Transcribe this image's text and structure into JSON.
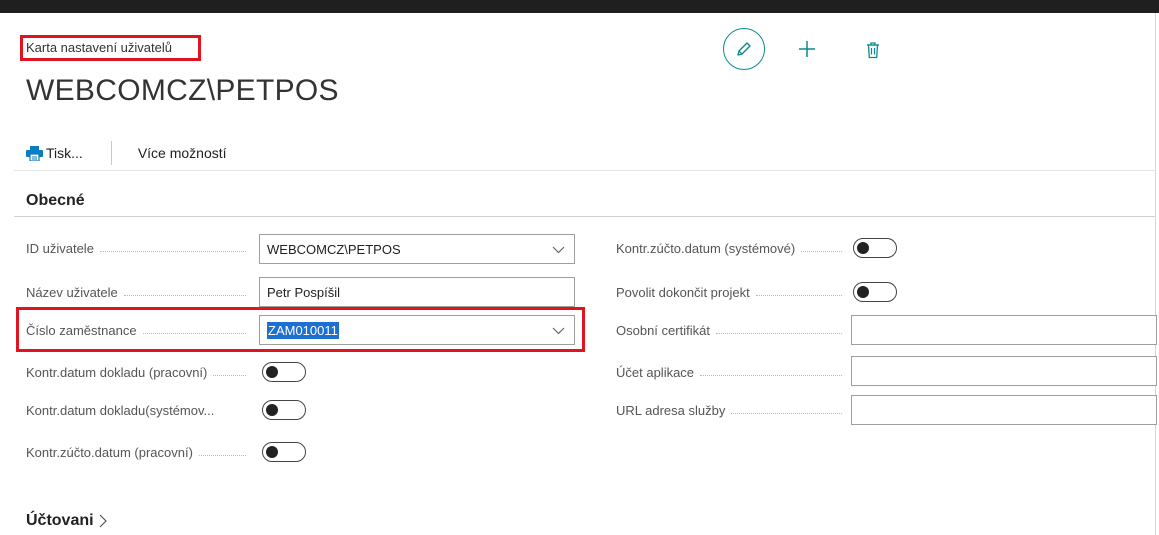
{
  "header": {
    "breadcrumb": "Karta nastavení uživatelů",
    "title": "WEBCOMCZ\\PETPOS"
  },
  "actions": {
    "print_label": "Tisk...",
    "more_label": "Více možností"
  },
  "section": {
    "title": "Obecné"
  },
  "left_fields": {
    "user_id": {
      "label": "ID uživatele",
      "value": "WEBCOMCZ\\PETPOS"
    },
    "user_name": {
      "label": "Název uživatele",
      "value": "Petr Pospíšil"
    },
    "employee_no": {
      "label": "Číslo zaměstnance",
      "value": "ZAM010011"
    },
    "doc_date_work": {
      "label": "Kontr.datum dokladu (pracovní)",
      "enabled": false
    },
    "doc_date_sys": {
      "label": "Kontr.datum dokladu(systémov...",
      "enabled": false
    },
    "post_date_work": {
      "label": "Kontr.zúčto.datum (pracovní)",
      "enabled": false
    }
  },
  "right_fields": {
    "post_date_sys": {
      "label": "Kontr.zúčto.datum (systémové)",
      "enabled": false
    },
    "allow_finish_project": {
      "label": "Povolit dokončit projekt",
      "enabled": false
    },
    "personal_cert": {
      "label": "Osobní certifikát",
      "value": ""
    },
    "app_account": {
      "label": "Účet aplikace",
      "value": ""
    },
    "service_url": {
      "label": "URL adresa služby",
      "value": ""
    }
  },
  "footer_section": {
    "title": "Účtovani"
  },
  "colors": {
    "accent": "#0a8a8a",
    "highlight": "#e0141e",
    "selection": "#1d6fd1",
    "print_icon": "#0a7cc1"
  }
}
